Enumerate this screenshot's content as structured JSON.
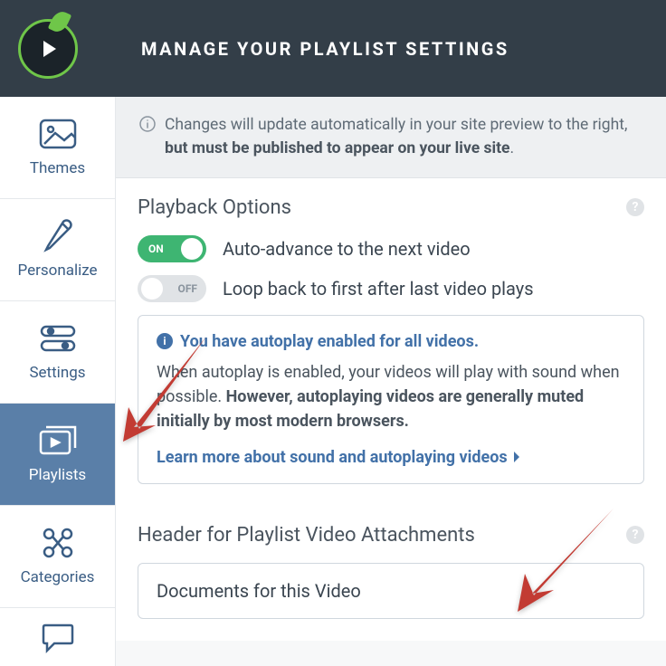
{
  "header": {
    "title": "MANAGE YOUR PLAYLIST SETTINGS"
  },
  "sidebar": {
    "items": [
      {
        "label": "Themes"
      },
      {
        "label": "Personalize"
      },
      {
        "label": "Settings"
      },
      {
        "label": "Playlists"
      },
      {
        "label": "Categories"
      }
    ]
  },
  "banner": {
    "text_prefix": "Changes will update automatically in your site preview to the right, ",
    "text_bold": "but must be published to appear on your live site",
    "text_suffix": "."
  },
  "playback": {
    "title": "Playback Options",
    "opt1": {
      "state": "ON",
      "label": "Auto-advance to the next video"
    },
    "opt2": {
      "state": "OFF",
      "label": "Loop back to first after last video plays"
    }
  },
  "alert": {
    "title": "You have autoplay enabled for all videos.",
    "body_prefix": "When autoplay is enabled, your videos will play with sound when possible. ",
    "body_bold": "However, autoplaying videos are generally muted initially by most modern browsers.",
    "link": "Learn more about sound and autoplaying videos"
  },
  "attachments": {
    "title": "Header for Playlist Video Attachments",
    "value": "Documents for this Video"
  }
}
